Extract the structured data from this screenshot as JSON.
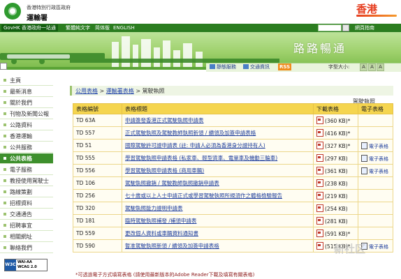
{
  "header": {
    "government": "香港特別行政區政府",
    "department": "運輸署",
    "brand": "香港"
  },
  "nav": {
    "govhk": "GovHK 香港政府一站通",
    "traditional": "繁體純文字",
    "simplified": "简体版",
    "english": "ENGLISH",
    "search_placeholder": "",
    "sitemap": "網頁指南"
  },
  "banner": {
    "title": "路路暢通"
  },
  "toolbar": {
    "register": "靜態服務",
    "traffic": "交通資訊",
    "rss": "RSS",
    "font_size_label": "字型大小:",
    "font_sizes": [
      "A",
      "A",
      "A"
    ]
  },
  "sidebar": {
    "items": [
      {
        "label": "主頁",
        "active": false
      },
      {
        "label": "最新消息",
        "active": false
      },
      {
        "label": "關於我們",
        "active": false
      },
      {
        "label": "刊物及新聞公報",
        "active": false
      },
      {
        "label": "公路資料",
        "active": false
      },
      {
        "label": "香港運輸",
        "active": false
      },
      {
        "label": "公共服務",
        "active": false
      },
      {
        "label": "公共表格",
        "active": true
      },
      {
        "label": "電子服務",
        "active": false
      },
      {
        "label": "教授使用駕駛士",
        "active": false
      },
      {
        "label": "路線策劃",
        "active": false
      },
      {
        "label": "招標資料",
        "active": false
      },
      {
        "label": "交通通告",
        "active": false
      },
      {
        "label": "招聘事宜",
        "active": false
      },
      {
        "label": "相關網址",
        "active": false
      },
      {
        "label": "聯絡我們",
        "active": false
      }
    ],
    "w3c_left": "W3C",
    "w3c_line1": "WAI-AA",
    "w3c_line2": "WCAG 2.0"
  },
  "breadcrumb": {
    "items": [
      "公用表格",
      "運輸署表格",
      "駕駛執照"
    ]
  },
  "page_title": "駕駛執照",
  "table": {
    "headers": [
      "表格編號",
      "表格標題",
      "下載表格",
      "電子表格"
    ],
    "rows": [
      {
        "code": "TD 63A",
        "title": "申請簽發香港正式駕駛執照申請表",
        "size": "(360 KB)*",
        "eform": ""
      },
      {
        "code": "TD 557",
        "title": "正式駕駛執照及駕駛教師執照新領 / 續領及加簽申請表格",
        "size": "(416 KB)*",
        "eform": ""
      },
      {
        "code": "TD 51",
        "title": "國際駕駛許可證申請表 (註: 申請人必須為香港身分證持有人)",
        "size": "(327 KB)*",
        "eform": "電子表格"
      },
      {
        "code": "TD 555",
        "title": "學習駕駛執照申請表格 (私家車、輕型貨車、電單車及機動三輪車)",
        "size": "(297 KB)",
        "eform": "電子表格"
      },
      {
        "code": "TD 556",
        "title": "學習駕駛執照申請表格 (商用車輛)",
        "size": "(361 KB)",
        "eform": "電子表格"
      },
      {
        "code": "TD 106",
        "title": "駕駛執照撤銷 / 駕駛教師執照撤銷申請表",
        "size": "(238 KB)",
        "eform": ""
      },
      {
        "code": "TD 256",
        "title": "七十歲或以上人士申請正式或學習駕駛執照所規須作之體格檢驗報告",
        "size": "(219 KB)",
        "eform": ""
      },
      {
        "code": "TD 320",
        "title": "駕駛執照能力證明申請表",
        "size": "(254 KB)",
        "eform": ""
      },
      {
        "code": "TD 181",
        "title": "臨時駕駛執照補發 /補領申請表",
        "size": "(281 KB)",
        "eform": ""
      },
      {
        "code": "TD 559",
        "title": "更改個人資料或車輛資料通知書",
        "size": "(591 KB)*",
        "eform": ""
      },
      {
        "code": "TD 590",
        "title": "暫准駕駛執照新領 / 續領及加簽申請表格",
        "size": "(515 KB)*",
        "eform": "電子表格"
      }
    ]
  },
  "footnote": "*可透過電子方式填寫表格 (請使用最新版本的Adobe Reader下載及填寫有關表格)",
  "watermark": "新社区"
}
